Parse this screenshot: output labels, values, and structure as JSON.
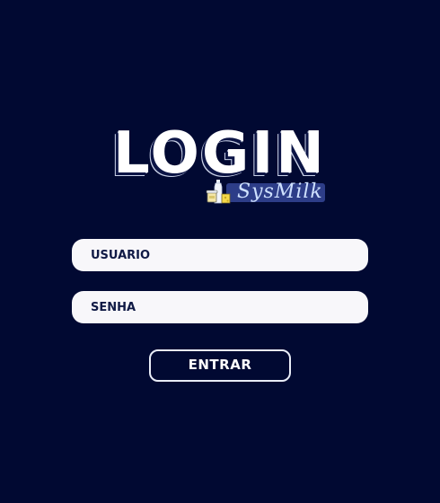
{
  "header": {
    "title": "LOGIN",
    "brand_name": "SysMilk",
    "brand_icon": "milk-products-icon"
  },
  "form": {
    "username_placeholder": "USUÁRIO",
    "password_placeholder": "SENHA",
    "submit_label": "ENTRAR"
  },
  "colors": {
    "background": "#010932",
    "field_background": "#f8f7fa",
    "field_text": "#101a45",
    "brand_band": "#2d3d88",
    "button_border": "#e9edf7"
  }
}
